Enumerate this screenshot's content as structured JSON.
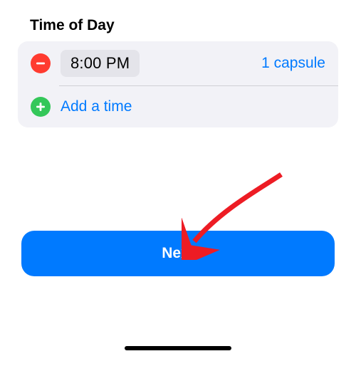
{
  "section_title": "Time of Day",
  "schedule_row": {
    "time": "8:00 PM",
    "dose": "1 capsule"
  },
  "add_row": {
    "label": "Add a time"
  },
  "next_button": {
    "label": "Next"
  }
}
